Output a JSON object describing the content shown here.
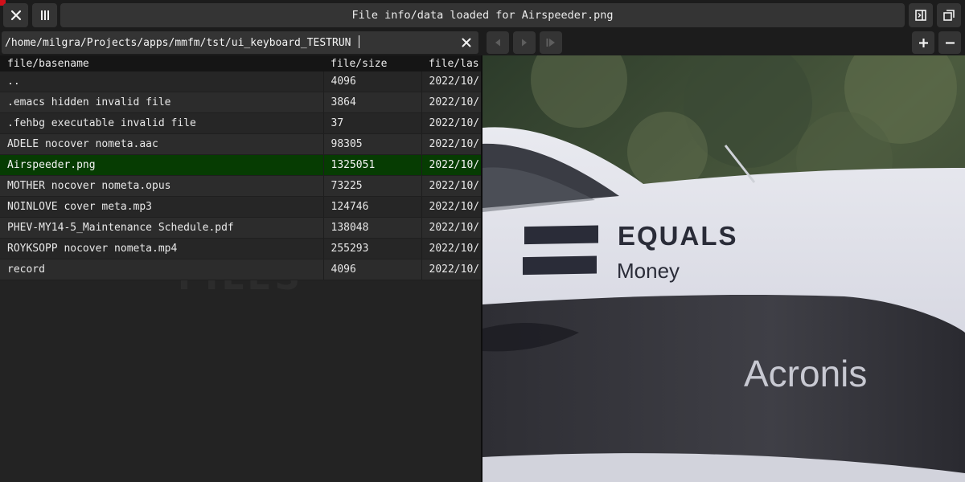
{
  "window": {
    "title": "File info/data loaded for Airspeeder.png"
  },
  "path_bar": {
    "value": "/home/milgra/Projects/apps/mmfm/tst/ui_keyboard_TESTRUN"
  },
  "file_list": {
    "watermark": "FILES",
    "columns": [
      "file/basename",
      "file/size",
      "file/las"
    ],
    "rows": [
      {
        "name": "..",
        "size": "4096",
        "date": "2022/10/"
      },
      {
        "name": ".emacs hidden invalid file",
        "size": "3864",
        "date": "2022/10/"
      },
      {
        "name": ".fehbg executable invalid file",
        "size": "37",
        "date": "2022/10/"
      },
      {
        "name": "ADELE nocover nometa.aac",
        "size": "98305",
        "date": "2022/10/"
      },
      {
        "name": "Airspeeder.png",
        "size": "1325051",
        "date": "2022/10/",
        "selected": true
      },
      {
        "name": "MOTHER nocover nometa.opus",
        "size": "73225",
        "date": "2022/10/"
      },
      {
        "name": "NOINLOVE cover meta.mp3",
        "size": "124746",
        "date": "2022/10/"
      },
      {
        "name": "PHEV-MY14-5_Maintenance Schedule.pdf",
        "size": "138048",
        "date": "2022/10/"
      },
      {
        "name": "ROYKSOPP nocover nometa.mp4",
        "size": "255293",
        "date": "2022/10/"
      },
      {
        "name": "record",
        "size": "4096",
        "date": "2022/10/"
      }
    ]
  },
  "preview": {
    "text_equals": "EQUALS",
    "text_money": "Money",
    "text_acronis": "Acronis"
  },
  "colors": {
    "selected_row": "#063c02",
    "button_bg": "#343434",
    "background": "#232323"
  },
  "icons": [
    "close-icon",
    "columns-icon",
    "panel-icon",
    "fullscreen-icon",
    "clear-icon",
    "prev-icon",
    "play-icon",
    "next-icon",
    "zoom-in-icon",
    "zoom-out-icon"
  ]
}
